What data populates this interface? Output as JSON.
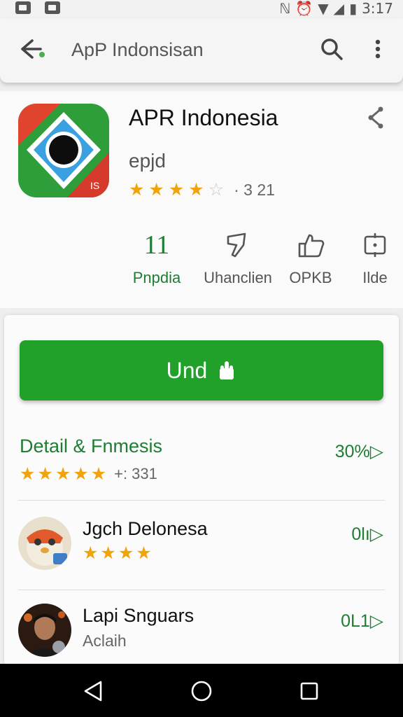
{
  "status_bar": {
    "time": "3:17"
  },
  "app_bar": {
    "title": "ApP Indonsisan"
  },
  "app": {
    "name": "APR Indonesia",
    "developer": "epjd",
    "rating": 3.5,
    "rating_count": "· 3 21"
  },
  "stats": [
    {
      "value": "11",
      "label": "Pnpdia"
    },
    {
      "icon": "tag-icon",
      "label": "Uhanclien"
    },
    {
      "icon": "thumbs-up-icon",
      "label": "OPKB"
    },
    {
      "icon": "calendar-icon",
      "label": "Ilde"
    }
  ],
  "install": {
    "label": "Und",
    "icon": "hand-icon"
  },
  "details": {
    "title": "Detail & Fnmesis",
    "rating": 5,
    "count": "+: 331",
    "right": "30%▷"
  },
  "reviews": [
    {
      "name": "Jgch Delonesa",
      "rating": 4,
      "right": "0lı▷"
    },
    {
      "name": "Lapi Snguars",
      "sub": "Aclaih",
      "right": "0L1▷"
    }
  ],
  "colors": {
    "accent_green": "#21a02a",
    "text_green": "#1e7d32",
    "star": "#f0a30a"
  }
}
